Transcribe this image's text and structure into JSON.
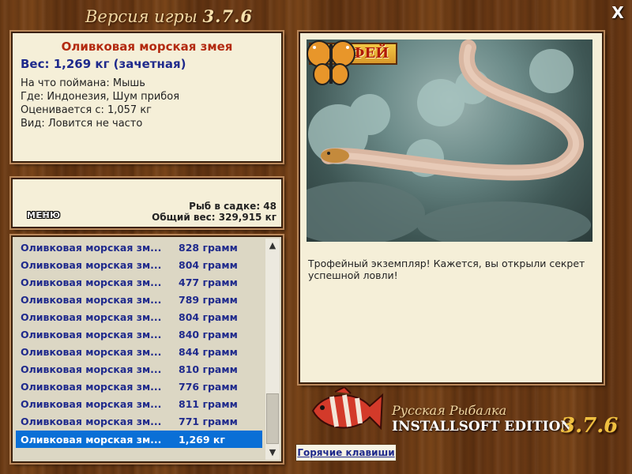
{
  "window": {
    "title_prefix": "Версия игры",
    "title_version": "3.7.6",
    "close_label": "X"
  },
  "fish_info": {
    "name": "Оливковая морская змея",
    "weight": "Вес: 1,269 кг (зачетная)",
    "bait": "На что поймана: Мышь",
    "location": "Где: Индонезия, Шум прибоя",
    "threshold": "Оценивается с: 1,057 кг",
    "rarity": "Вид: Ловится не часто"
  },
  "stats": {
    "menu_label": "МЕНЮ",
    "fish_count": "Рыб в садке: 48",
    "total_weight": "Общий вес: 329,915 кг"
  },
  "catch_list": {
    "rows": [
      {
        "name": "Оливковая морская зм...",
        "weight": "828 грамм"
      },
      {
        "name": "Оливковая морская зм...",
        "weight": "804 грамм"
      },
      {
        "name": "Оливковая морская зм...",
        "weight": "477 грамм"
      },
      {
        "name": "Оливковая морская зм...",
        "weight": "789 грамм"
      },
      {
        "name": "Оливковая морская зм...",
        "weight": "804 грамм"
      },
      {
        "name": "Оливковая морская зм...",
        "weight": "840 грамм"
      },
      {
        "name": "Оливковая морская зм...",
        "weight": "844 грамм"
      },
      {
        "name": "Оливковая морская зм...",
        "weight": "810 грамм"
      },
      {
        "name": "Оливковая морская зм...",
        "weight": "776 грамм"
      },
      {
        "name": "Оливковая морская зм...",
        "weight": "811 грамм"
      },
      {
        "name": "Оливковая морская зм...",
        "weight": "771 грамм"
      },
      {
        "name": "Оливковая морская зм...",
        "weight": "1,269 кг"
      }
    ],
    "selected_index": 11,
    "scroll_up_icon": "chevron-up-icon",
    "scroll_down_icon": "chevron-down-icon"
  },
  "trophy": {
    "badge": "ТРОФЕЙ",
    "description": "Трофейный экземпляр! Кажется, вы открыли секрет успешной ловли!"
  },
  "footer": {
    "hotkeys_label": "Горячие клавиши",
    "brand_line1": "Русская Рыбалка",
    "brand_line2": "INSTALLSOFT EDITION",
    "brand_version": "3.7.6"
  },
  "colors": {
    "wood": "#6b3a14",
    "panel": "#f5efd8",
    "fish_name": "#b32a10",
    "list_text": "#1f2a8c",
    "selection": "#0a6fd6"
  }
}
